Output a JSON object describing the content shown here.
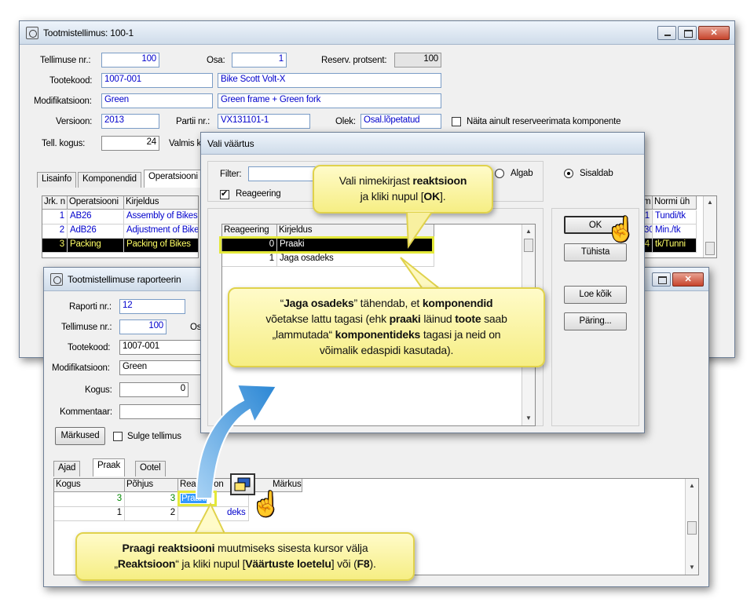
{
  "main_window": {
    "title": "Tootmistellimus: 100-1",
    "fields": {
      "tellimuse_nr_label": "Tellimuse nr.:",
      "tellimuse_nr": "100",
      "osa_label": "Osa:",
      "osa": "1",
      "reserv_label": "Reserv. protsent:",
      "reserv": "100",
      "tootekood_label": "Tootekood:",
      "tootekood": "1007-001",
      "toote_nimi": "Bike Scott Volt-X",
      "modifikatsioon_label": "Modifikatsioon:",
      "modifikatsioon": "Green",
      "modifikatsiooni_kirjeldus": "Green frame + Green fork",
      "versioon_label": "Versioon:",
      "versioon": "2013",
      "partii_label": "Partii nr.:",
      "partii": "VX131101-1",
      "olek_label": "Olek:",
      "olek": "Osal.lõpetatud",
      "naita_label": "Näita ainult reserveerimata komponente",
      "tell_kogus_label": "Tell. kogus:",
      "tell_kogus": "24",
      "valmis_label": "Valmis k"
    },
    "tabs": [
      "Lisainfo",
      "Komponendid",
      "Operatsiooni"
    ],
    "ops_headers": [
      "Jrk. n",
      "Operatsiooni",
      "Kirjeldus"
    ],
    "ops_rows": [
      {
        "nr": "1",
        "code": "AB26",
        "desc": "Assembly of Bikes"
      },
      {
        "nr": "2",
        "code": "AdB26",
        "desc": "Adjustment of Bike"
      },
      {
        "nr": "3",
        "code": "Packing",
        "desc": "Packing of Bikes"
      }
    ],
    "ops_right_headers": [
      "m",
      "Normi üh"
    ],
    "ops_right_rows": [
      {
        "m": "1",
        "unit": "Tundi/tk"
      },
      {
        "m": "30",
        "unit": "Min./tk"
      },
      {
        "m": "4",
        "unit": "tk/Tunni"
      }
    ]
  },
  "report_window": {
    "title": "Tootmistellimuse raporteerin",
    "fields": {
      "raporti_nr_label": "Raporti nr.:",
      "raporti_nr": "12",
      "tellimuse_nr_label": "Tellimuse nr.:",
      "tellimuse_nr": "100",
      "osa_label": "Os",
      "tootekood_label": "Tootekood:",
      "tootekood": "1007-001",
      "modifikatsioon_label": "Modifikatsioon:",
      "modifikatsioon": "Green",
      "kogus_label": "Kogus:",
      "kogus": "0",
      "kommentaar_label": "Kommentaar:"
    },
    "markused_button": "Märkused",
    "sulge_label": "Sulge tellimus",
    "tabs": [
      "Ajad",
      "Praak",
      "Ootel"
    ],
    "grid_headers": [
      "Kogus",
      "Põhjus",
      "Reaktsioon",
      "Märkused"
    ],
    "grid_rows": [
      {
        "kogus": "3",
        "pohjus": "3",
        "reaktsioon": "Praaki"
      },
      {
        "kogus": "1",
        "pohjus": "2",
        "reaktsioon": "deks"
      }
    ]
  },
  "dialog": {
    "title": "Vali väärtus",
    "filter_label": "Filter:",
    "algab_label": "Algab",
    "sisaldab_label": "Sisaldab",
    "reageering_label": "Reageering",
    "list_headers": [
      "Reageering",
      "Kirjeldus"
    ],
    "list_rows": [
      {
        "code": "0",
        "desc": "Praaki"
      },
      {
        "code": "1",
        "desc": "Jaga osadeks"
      }
    ],
    "buttons": {
      "ok": "OK",
      "tuhista": "Tühista",
      "loe_koik": "Loe kõik",
      "paring": "Päring..."
    }
  },
  "callouts": {
    "c1": {
      "line1_a": "Vali nimekirjast ",
      "line1_b": "reaktsioon",
      "line2_a": "ja kliki nupul [",
      "line2_b": "OK",
      "line2_c": "]."
    },
    "c2": {
      "l1_a": "“",
      "l1_b": "Jaga osadeks",
      "l1_c": "” tähendab, et ",
      "l1_d": "komponendid",
      "l2_a": "võetakse lattu tagasi (ehk ",
      "l2_b": "praaki",
      "l2_c": " läinud ",
      "l2_d": "toote",
      "l2_e": " saab",
      "l3_a": "„lammutada“ ",
      "l3_b": "komponentideks",
      "l3_c": " tagasi ja neid on",
      "l4": "võimalik edaspidi kasutada)."
    },
    "c3": {
      "l1_a": "Praagi reaktsiooni",
      "l1_b": " muutmiseks sisesta kursor välja",
      "l2_a": "„",
      "l2_b": "Reaktsioon",
      "l2_c": "“ ja kliki nupul [",
      "l2_d": "Väärtuste loetelu",
      "l2_e": "] või (",
      "l2_f": "F8",
      "l2_g": ")."
    }
  },
  "colors": {
    "field_text": "#0000cc",
    "callout_fill": "#fdf6a8",
    "arrow": "#3c8fd6"
  }
}
